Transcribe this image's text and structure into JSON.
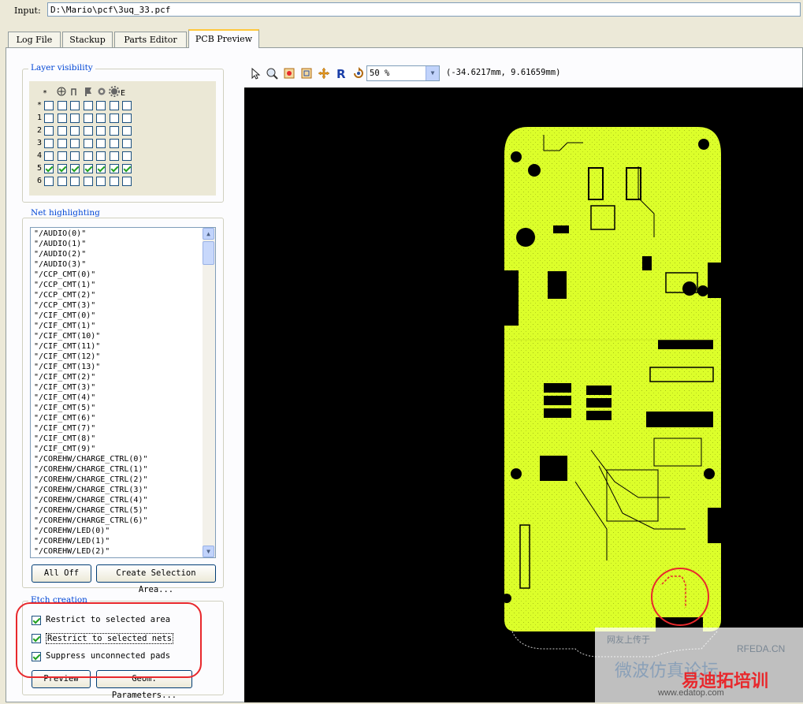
{
  "input": {
    "label": "Input:",
    "value": "D:\\Mario\\pcf\\3uq_33.pcf"
  },
  "tabs": [
    {
      "label": "Log File"
    },
    {
      "label": "Stackup"
    },
    {
      "label": "Parts Editor"
    },
    {
      "label": "PCB Preview",
      "active": true
    }
  ],
  "layer_visibility": {
    "title": "Layer visibility",
    "header_icons": [
      "asterisk-icon",
      "copper-icon",
      "trace-icon",
      "flag-icon",
      "circle-icon",
      "gear-icon"
    ],
    "header_star": "*",
    "header_e": "E",
    "rows": [
      {
        "label": "*",
        "checked": [
          false,
          false,
          false,
          false,
          false,
          false,
          false
        ]
      },
      {
        "label": "1",
        "checked": [
          false,
          false,
          false,
          false,
          false,
          false,
          false
        ]
      },
      {
        "label": "2",
        "checked": [
          false,
          false,
          false,
          false,
          false,
          false,
          false
        ]
      },
      {
        "label": "3",
        "checked": [
          false,
          false,
          false,
          false,
          false,
          false,
          false
        ]
      },
      {
        "label": "4",
        "checked": [
          false,
          false,
          false,
          false,
          false,
          false,
          false
        ]
      },
      {
        "label": "5",
        "checked": [
          true,
          true,
          true,
          true,
          true,
          true,
          true
        ]
      },
      {
        "label": "6",
        "checked": [
          false,
          false,
          false,
          false,
          false,
          false,
          false
        ]
      }
    ]
  },
  "net_highlighting": {
    "title": "Net highlighting",
    "items": [
      "\"/AUDIO(0)\"",
      "\"/AUDIO(1)\"",
      "\"/AUDIO(2)\"",
      "\"/AUDIO(3)\"",
      "\"/CCP_CMT(0)\"",
      "\"/CCP_CMT(1)\"",
      "\"/CCP_CMT(2)\"",
      "\"/CCP_CMT(3)\"",
      "\"/CIF_CMT(0)\"",
      "\"/CIF_CMT(1)\"",
      "\"/CIF_CMT(10)\"",
      "\"/CIF_CMT(11)\"",
      "\"/CIF_CMT(12)\"",
      "\"/CIF_CMT(13)\"",
      "\"/CIF_CMT(2)\"",
      "\"/CIF_CMT(3)\"",
      "\"/CIF_CMT(4)\"",
      "\"/CIF_CMT(5)\"",
      "\"/CIF_CMT(6)\"",
      "\"/CIF_CMT(7)\"",
      "\"/CIF_CMT(8)\"",
      "\"/CIF_CMT(9)\"",
      "\"/COREHW/CHARGE_CTRL(0)\"",
      "\"/COREHW/CHARGE_CTRL(1)\"",
      "\"/COREHW/CHARGE_CTRL(2)\"",
      "\"/COREHW/CHARGE_CTRL(3)\"",
      "\"/COREHW/CHARGE_CTRL(4)\"",
      "\"/COREHW/CHARGE_CTRL(5)\"",
      "\"/COREHW/CHARGE_CTRL(6)\"",
      "\"/COREHW/LED(0)\"",
      "\"/COREHW/LED(1)\"",
      "\"/COREHW/LED(2)\""
    ],
    "all_off_label": "All Off",
    "create_area_label": "Create Selection Area..."
  },
  "etch_creation": {
    "title": "Etch creation",
    "options": [
      {
        "label": "Restrict to selected area",
        "checked": true
      },
      {
        "label": "Restrict to selected nets",
        "checked": true
      },
      {
        "label": "Suppress unconnected pads",
        "checked": true
      }
    ],
    "preview_label": "Preview",
    "geom_label": "Geom. Parameters..."
  },
  "toolbar": {
    "icons": [
      "pointer-icon",
      "zoom-icon",
      "zoom-fit-icon",
      "zoom-area-icon",
      "pan-icon",
      "refresh-icon",
      "rotate-icon"
    ],
    "zoom_value": "50 %",
    "coordinates": "(-34.6217mm, 9.61659mm)"
  },
  "watermark": {
    "line1": "网友上传于",
    "line2": "微波仿真论坛",
    "brand": "RFEDA.CN",
    "logo": "易迪拓培训",
    "url": "www.edatop.com"
  },
  "colors": {
    "pcb": "#dcff2a",
    "canvas": "#000000",
    "highlight": "#e8282c",
    "accent": "#ffc83c"
  }
}
